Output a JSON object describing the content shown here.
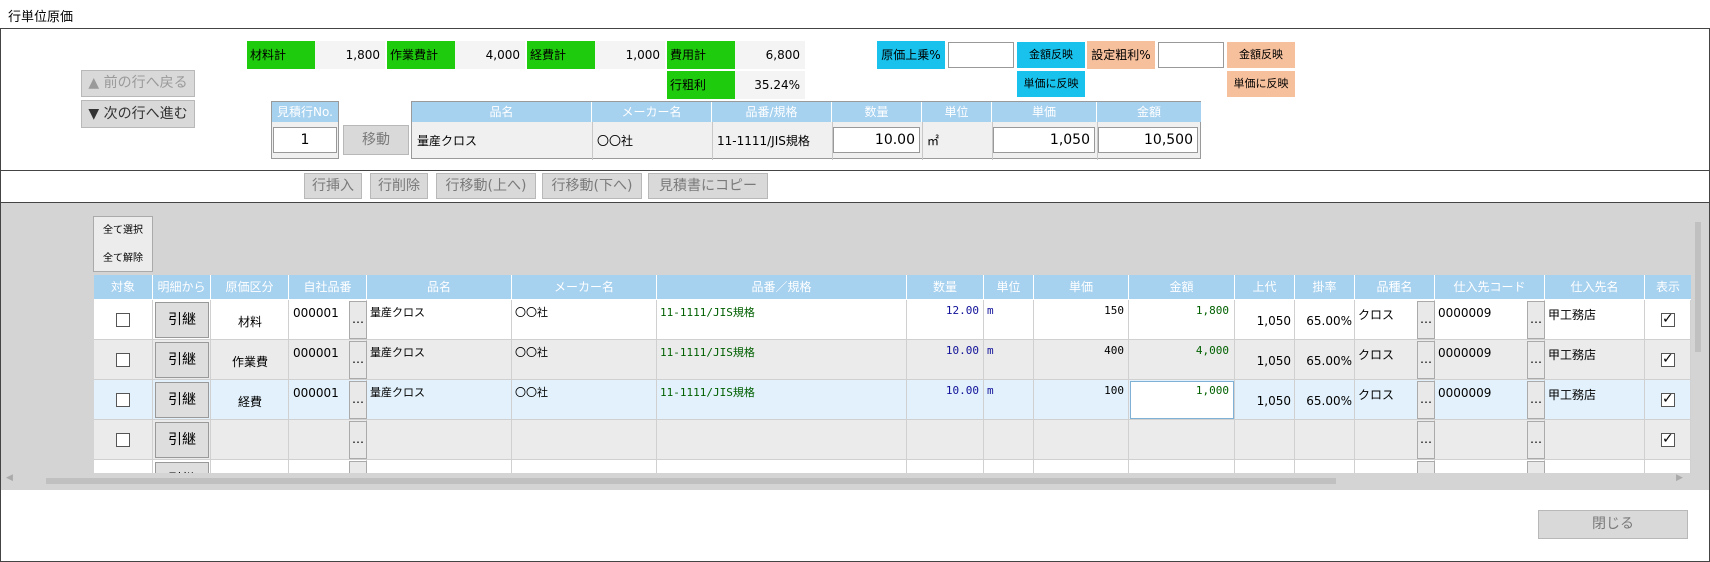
{
  "window_title": "行単位原価",
  "summary": {
    "material_label": "材料計",
    "material_value": "1,800",
    "work_label": "作業費計",
    "work_value": "4,000",
    "expense_label": "経費計",
    "expense_value": "1,000",
    "cost_label": "費用計",
    "cost_value": "6,800",
    "margin_label": "行粗利",
    "margin_value": "35.24%",
    "markup_label": "原価上乗%",
    "markup_amount_btn": "金額反映",
    "markup_unit_btn": "単価に反映",
    "target_label": "設定粗利%",
    "target_amount_btn": "金額反映",
    "target_unit_btn": "単価に反映"
  },
  "nav": {
    "prev": "▲ 前の行へ戻る",
    "next": "▼ 次の行へ進む"
  },
  "line": {
    "no_header": "見積行No.",
    "no_value": "1",
    "move_btn": "移動",
    "headers": [
      "品名",
      "メーカー名",
      "品番/規格",
      "数量",
      "単位",
      "単価",
      "金額"
    ],
    "name": "量産クロス",
    "maker": "〇〇社",
    "spec": "11-1111/JIS規格",
    "qty": "10.00",
    "unit": "㎡",
    "price": "1,050",
    "amount": "10,500"
  },
  "toolbar": [
    "行挿入",
    "行削除",
    "行移動(上へ)",
    "行移動(下へ)",
    "見積書にコピー"
  ],
  "select_all": "全て選択",
  "deselect_all": "全て解除",
  "grid": {
    "headers": [
      "対象",
      "明細から",
      "原価区分",
      "自社品番",
      "品名",
      "メーカー名",
      "品番／規格",
      "数量",
      "単位",
      "単価",
      "金額",
      "上代",
      "掛率",
      "品種名",
      "仕入先コード",
      "仕入先名",
      "表示"
    ],
    "pull_label": "引継",
    "dots": "…",
    "rows": [
      {
        "kubun": "材料",
        "code": "000001",
        "name": "量産クロス",
        "maker": "〇〇社",
        "spec": "11-1111/JIS規格",
        "qty": "12.00",
        "unit": "m",
        "price": "150",
        "amount": "1,800",
        "retail": "1,050",
        "rate": "65.00%",
        "kind": "クロス",
        "supplier_code": "0000009",
        "supplier": "甲工務店",
        "shown": true
      },
      {
        "kubun": "作業費",
        "code": "000001",
        "name": "量産クロス",
        "maker": "〇〇社",
        "spec": "11-1111/JIS規格",
        "qty": "10.00",
        "unit": "m",
        "price": "400",
        "amount": "4,000",
        "retail": "1,050",
        "rate": "65.00%",
        "kind": "クロス",
        "supplier_code": "0000009",
        "supplier": "甲工務店",
        "shown": true
      },
      {
        "kubun": "経費",
        "code": "000001",
        "name": "量産クロス",
        "maker": "〇〇社",
        "spec": "11-1111/JIS規格",
        "qty": "10.00",
        "unit": "m",
        "price": "100",
        "amount": "1,000",
        "retail": "1,050",
        "rate": "65.00%",
        "kind": "クロス",
        "supplier_code": "0000009",
        "supplier": "甲工務店",
        "shown": true
      },
      {
        "kubun": "",
        "code": "",
        "name": "",
        "maker": "",
        "spec": "",
        "qty": "",
        "unit": "",
        "price": "",
        "amount": "",
        "retail": "",
        "rate": "",
        "kind": "",
        "supplier_code": "",
        "supplier": "",
        "shown": true
      }
    ]
  },
  "close_btn": "閉じる"
}
